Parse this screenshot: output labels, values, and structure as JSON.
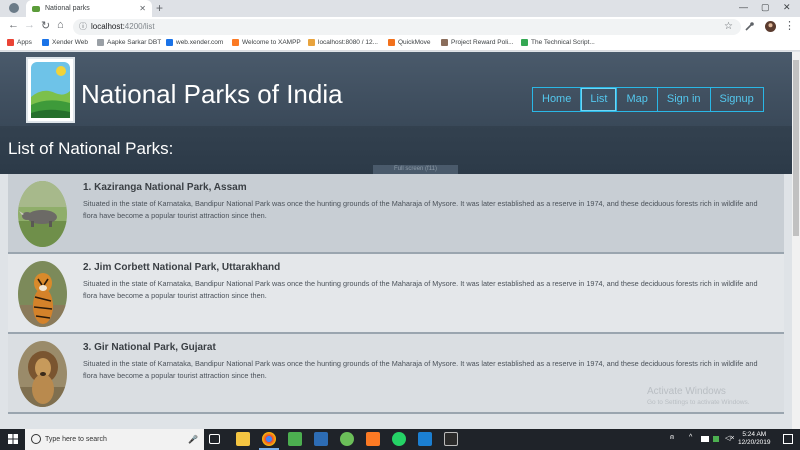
{
  "browser": {
    "tab_title": "National parks",
    "url_host": "localhost:",
    "url_path": "4200/list",
    "bookmarks": [
      {
        "label": "Apps",
        "color": "#ea4335"
      },
      {
        "label": "Xender Web",
        "color": "#1a73e8"
      },
      {
        "label": "Aapke Sarkar DBT",
        "color": "#9aa0a6"
      },
      {
        "label": "web.xender.com",
        "color": "#1a73e8"
      },
      {
        "label": "Welcome to XAMPP",
        "color": "#fb7a24"
      },
      {
        "label": "localhost:8080 / 12...",
        "color": "#e8a33d"
      },
      {
        "label": "QuickMove",
        "color": "#f2711c"
      },
      {
        "label": "Project Reward Poli...",
        "color": "#8a6d5b"
      },
      {
        "label": "The Technical Script...",
        "color": "#34a853"
      }
    ]
  },
  "site": {
    "title": "National Parks of India",
    "nav": [
      "Home",
      "List",
      "Map",
      "Sign in",
      "Signup"
    ],
    "active_nav": "List",
    "list_heading": "List of National Parks:",
    "ghost_tip": "Full screen (f11)"
  },
  "parks": [
    {
      "title": "1. Kaziranga National Park, Assam",
      "description": "Situated in the state of Karnataka, Bandipur National Park was once the hunting grounds of the Maharaja of Mysore. It was later established as a reserve in 1974, and these deciduous forests rich in wildlife and flora have become a popular tourist attraction since then.",
      "photo": "rhino"
    },
    {
      "title": "2. Jim Corbett National Park, Uttarakhand",
      "description": "Situated in the state of Karnataka, Bandipur National Park was once the hunting grounds of the Maharaja of Mysore. It was later established as a reserve in 1974, and these deciduous forests rich in wildlife and flora have become a popular tourist attraction since then.",
      "photo": "tiger"
    },
    {
      "title": "3. Gir National Park, Gujarat",
      "description": "Situated in the state of Karnataka, Bandipur National Park was once the hunting grounds of the Maharaja of Mysore. It was later established as a reserve in 1974, and these deciduous forests rich in wildlife and flora have become a popular tourist attraction since then.",
      "photo": "lion"
    }
  ],
  "watermark": {
    "line1": "Activate Windows",
    "line2": "Go to Settings to activate Windows."
  },
  "taskbar": {
    "search_placeholder": "Type here to search",
    "time": "5:24 AM",
    "date": "12/20/2019"
  },
  "colors": {
    "header_bg": "#4a5a6b",
    "nav_accent": "#2ab7e6",
    "card_border": "#9aa5af"
  }
}
